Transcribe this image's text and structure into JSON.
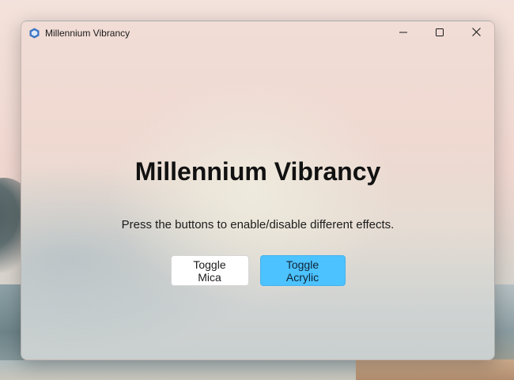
{
  "window": {
    "title": "Millennium Vibrancy",
    "icon": "hexagon-app-icon",
    "controls": {
      "minimize": "minimize-icon",
      "maximize": "maximize-icon",
      "close": "close-icon"
    }
  },
  "main": {
    "heading": "Millennium Vibrancy",
    "subtitle": "Press the buttons to enable/disable different effects.",
    "buttons": {
      "mica": "Toggle Mica",
      "acrylic": "Toggle Acrylic"
    }
  },
  "colors": {
    "accent": "#4cc2ff",
    "secondary_button": "#ffffff"
  }
}
